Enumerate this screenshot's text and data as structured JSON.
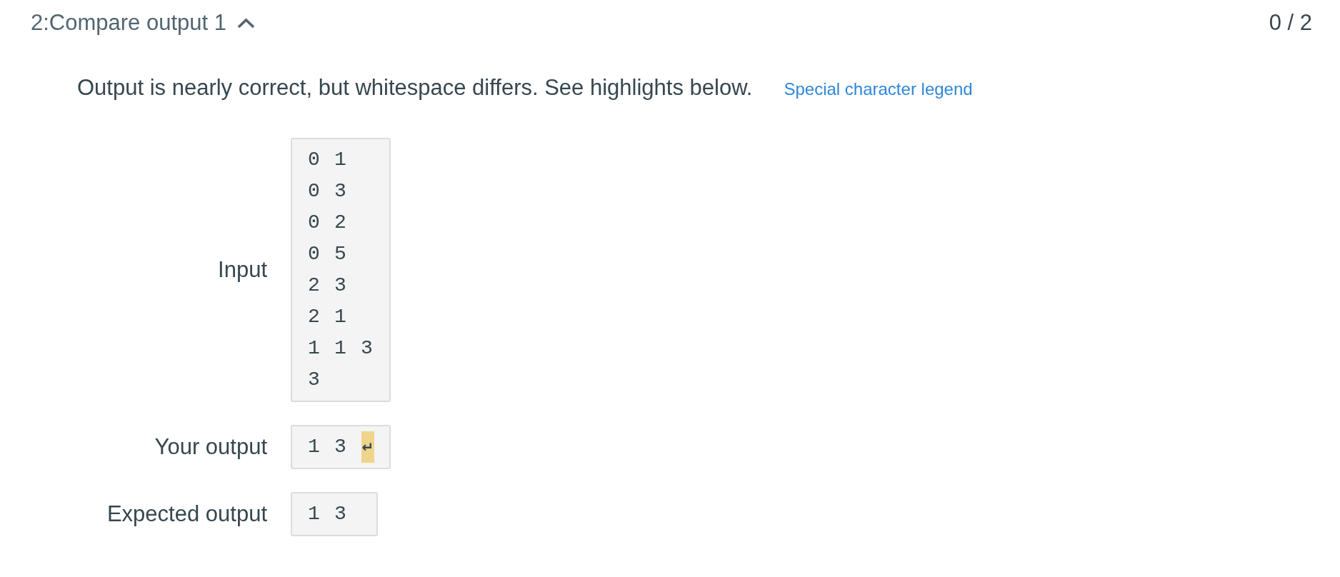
{
  "section": {
    "title": "2:Compare output 1",
    "expanded": true,
    "score": "0 / 2"
  },
  "message": {
    "text": "Output is nearly correct, but whitespace differs. See highlights below.",
    "link": "Special character legend"
  },
  "rows": [
    {
      "kind": "input",
      "label": "Input",
      "lines": [
        "0 1",
        "0 3",
        "0 2",
        "0 5",
        "2 3",
        "2 1",
        "1 1 3",
        "3"
      ]
    },
    {
      "kind": "output",
      "label": "Your output",
      "lines": [
        "1 3"
      ],
      "newline_marker": "↵"
    },
    {
      "kind": "output",
      "label": "Expected output",
      "lines": [
        "1 3"
      ]
    }
  ]
}
